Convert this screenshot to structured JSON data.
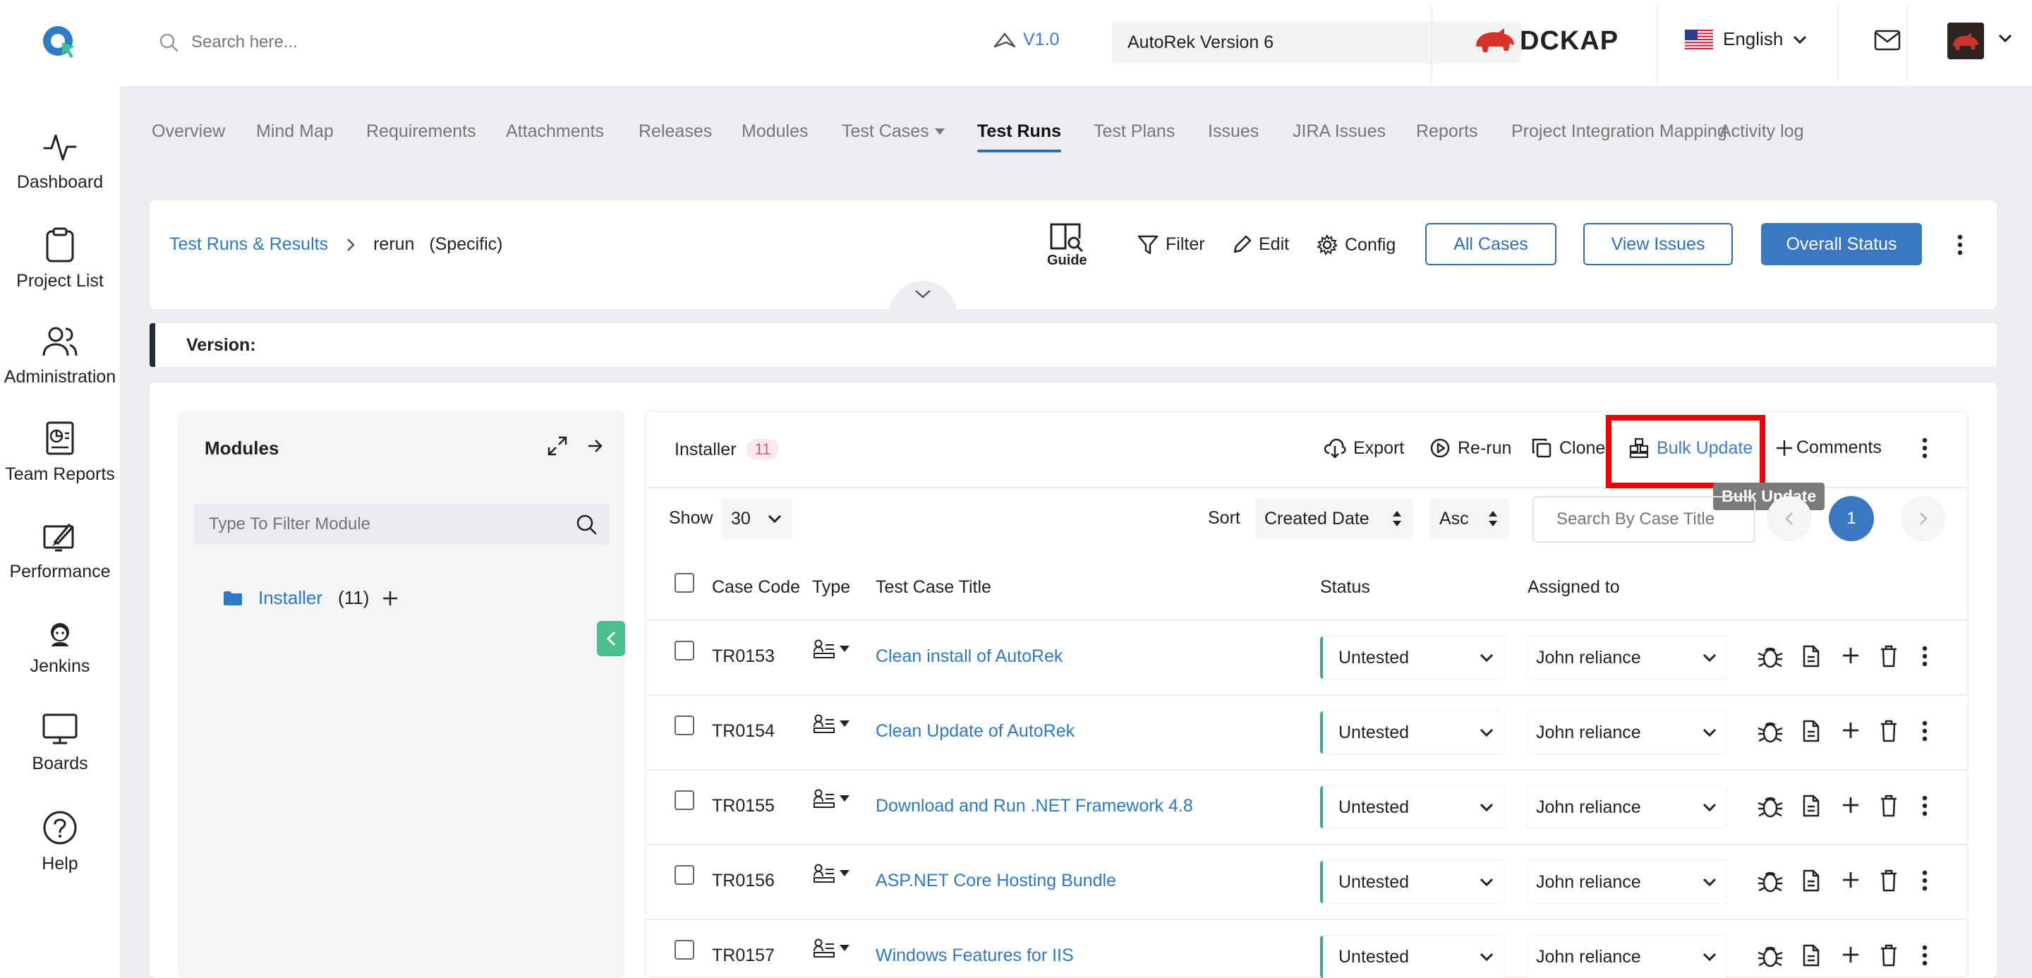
{
  "header": {
    "search_placeholder": "Search here...",
    "version_link": "V1.0",
    "project_select": "AutoRek Version 6",
    "brand": "DCKAP",
    "language": "English"
  },
  "sidebar": {
    "items": [
      {
        "label": "Dashboard",
        "icon": "activity-icon"
      },
      {
        "label": "Project List",
        "icon": "clipboard-icon"
      },
      {
        "label": "Administration",
        "icon": "users-icon"
      },
      {
        "label": "Team Reports",
        "icon": "report-icon"
      },
      {
        "label": "Performance",
        "icon": "rocket-icon"
      },
      {
        "label": "Jenkins",
        "icon": "jenkins-icon"
      },
      {
        "label": "Boards",
        "icon": "monitor-icon"
      },
      {
        "label": "Help",
        "icon": "help-icon"
      }
    ]
  },
  "tabs": [
    "Overview",
    "Mind Map",
    "Requirements",
    "Attachments",
    "Releases",
    "Modules",
    "Test Cases",
    "Test Runs",
    "Test Plans",
    "Issues",
    "JIRA Issues",
    "Reports",
    "Project Integration Mapping",
    "Activity log"
  ],
  "active_tab": "Test Runs",
  "toolbar": {
    "breadcrumb_root": "Test Runs & Results",
    "breadcrumb_current": "rerun",
    "breadcrumb_qualifier": "(Specific)",
    "guide": "Guide",
    "filter": "Filter",
    "edit": "Edit",
    "config": "Config",
    "all_cases": "All Cases",
    "view_issues": "View Issues",
    "overall_status": "Overall Status"
  },
  "version_label": "Version:",
  "modules": {
    "title": "Modules",
    "filter_placeholder": "Type To Filter Module",
    "items": [
      {
        "name": "Installer",
        "count": "(11)"
      }
    ]
  },
  "cases": {
    "module_name": "Installer",
    "count": "11",
    "actions": {
      "export": "Export",
      "rerun": "Re-run",
      "clone": "Clone",
      "bulk_update": "Bulk Update",
      "comments": "Comments"
    },
    "tooltip": "Bulk Update",
    "show_label": "Show",
    "show_value": "30",
    "sort_label": "Sort",
    "sort_field": "Created Date",
    "sort_order": "Asc",
    "search_placeholder": "Search By Case Title",
    "current_page": "1",
    "columns": {
      "code": "Case Code",
      "type": "Type",
      "title": "Test Case Title",
      "status": "Status",
      "assigned": "Assigned to"
    },
    "rows": [
      {
        "code": "TR0153",
        "title": "Clean install of AutoRek",
        "status": "Untested",
        "assignee": "John reliance"
      },
      {
        "code": "TR0154",
        "title": "Clean Update of AutoRek",
        "status": "Untested",
        "assignee": "John reliance"
      },
      {
        "code": "TR0155",
        "title": "Download and Run .NET Framework 4.8",
        "status": "Untested",
        "assignee": "John reliance"
      },
      {
        "code": "TR0156",
        "title": "ASP.NET Core Hosting Bundle",
        "status": "Untested",
        "assignee": "John reliance"
      },
      {
        "code": "TR0157",
        "title": "Windows Features for IIS",
        "status": "Untested",
        "assignee": "John reliance"
      }
    ]
  },
  "colors": {
    "primary": "#3b78c4",
    "link": "#2d78c8",
    "highlight": "#f00000",
    "status_border": "#3aa89a"
  }
}
